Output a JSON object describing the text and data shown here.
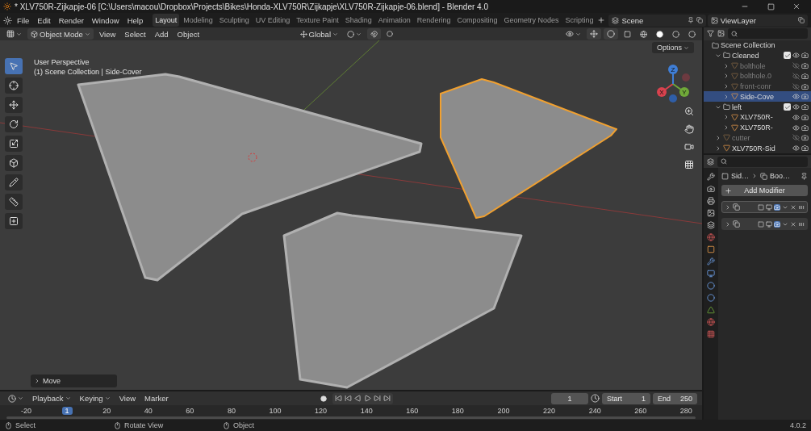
{
  "window": {
    "title": "* XLV750R-Zijkapje-06 [C:\\Users\\macou\\Dropbox\\Projects\\Bikes\\Honda-XLV750R\\Zijkapje\\XLV750R-Zijkapje-06.blend] - Blender 4.0"
  },
  "menu": [
    "File",
    "Edit",
    "Render",
    "Window",
    "Help"
  ],
  "workspaces": [
    {
      "label": "Layout",
      "selected": true
    },
    {
      "label": "Modeling",
      "selected": false
    },
    {
      "label": "Sculpting",
      "selected": false
    },
    {
      "label": "UV Editing",
      "selected": false
    },
    {
      "label": "Texture Paint",
      "selected": false
    },
    {
      "label": "Shading",
      "selected": false
    },
    {
      "label": "Animation",
      "selected": false
    },
    {
      "label": "Rendering",
      "selected": false
    },
    {
      "label": "Compositing",
      "selected": false
    },
    {
      "label": "Geometry Nodes",
      "selected": false
    },
    {
      "label": "Scripting",
      "selected": false
    }
  ],
  "scene": "Scene",
  "view_layer": "ViewLayer",
  "viewport_header": {
    "mode": "Object Mode",
    "menus": [
      "View",
      "Select",
      "Add",
      "Object"
    ],
    "orientation": "Global"
  },
  "viewport": {
    "perspective": "User Perspective",
    "context": "(1) Scene Collection | Side-Cover",
    "options": "Options",
    "gizmo_axes": [
      "X",
      "Y",
      "Z"
    ],
    "last_operator": "Move",
    "objects": [
      {
        "selected": false
      },
      {
        "selected": true
      },
      {
        "selected": false
      }
    ]
  },
  "outliner": {
    "root": "Scene Collection",
    "items": [
      {
        "kind": "collection",
        "name": "Cleaned",
        "checked": true,
        "visible": true,
        "disabled": false,
        "selected": false,
        "children": [
          {
            "kind": "mesh",
            "name": "bolthole",
            "visible": false,
            "disabled": true,
            "selected": false
          },
          {
            "kind": "mesh",
            "name": "bolthole.0",
            "visible": false,
            "disabled": true,
            "selected": false
          },
          {
            "kind": "mesh",
            "name": "front-conr",
            "visible": false,
            "disabled": true,
            "selected": false
          },
          {
            "kind": "mesh",
            "name": "Side-Cove",
            "visible": true,
            "disabled": false,
            "selected": true
          }
        ]
      },
      {
        "kind": "collection",
        "name": "left",
        "checked": true,
        "visible": true,
        "disabled": false,
        "selected": false,
        "children": [
          {
            "kind": "mesh",
            "name": "XLV750R-",
            "visible": true,
            "disabled": false,
            "selected": false
          },
          {
            "kind": "mesh",
            "name": "XLV750R-",
            "visible": true,
            "disabled": false,
            "selected": false
          }
        ]
      },
      {
        "kind": "mesh",
        "name": "cutter",
        "visible": false,
        "disabled": true,
        "selected": false
      },
      {
        "kind": "mesh",
        "name": "XLV750R-Sid",
        "visible": true,
        "disabled": false,
        "selected": false
      }
    ]
  },
  "properties": {
    "breadcrumb": [
      "Sid…",
      "Boo…"
    ],
    "add_modifier": "Add Modifier",
    "modifiers": [
      {
        "selected": true
      },
      {
        "selected": false
      }
    ]
  },
  "timeline": {
    "menus": [
      {
        "label": "Playback",
        "dropdown": true
      },
      {
        "label": "Keying",
        "dropdown": true
      },
      {
        "label": "View",
        "dropdown": false
      },
      {
        "label": "Marker",
        "dropdown": false
      }
    ],
    "current_frame": "1",
    "start_label": "Start",
    "start": "1",
    "end_label": "End",
    "end": "250",
    "ruler": [
      {
        "label": "-20",
        "current": false
      },
      {
        "label": "1",
        "current": true
      },
      {
        "label": "20",
        "current": false
      },
      {
        "label": "40",
        "current": false
      },
      {
        "label": "60",
        "current": false
      },
      {
        "label": "80",
        "current": false
      },
      {
        "label": "100",
        "current": false
      },
      {
        "label": "120",
        "current": false
      },
      {
        "label": "140",
        "current": false
      },
      {
        "label": "160",
        "current": false
      },
      {
        "label": "180",
        "current": false
      },
      {
        "label": "200",
        "current": false
      },
      {
        "label": "220",
        "current": false
      },
      {
        "label": "240",
        "current": false
      },
      {
        "label": "260",
        "current": false
      },
      {
        "label": "280",
        "current": false
      }
    ]
  },
  "status_bar": {
    "items": [
      "Select",
      "Rotate View",
      "Object"
    ],
    "version": "4.0.2"
  }
}
